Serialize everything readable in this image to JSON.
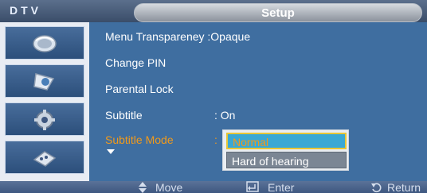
{
  "header": {
    "brand": "DTV",
    "title": "Setup"
  },
  "sidebar": {
    "items": [
      {
        "icon": "satellite-dish-icon"
      },
      {
        "icon": "picture-icon"
      },
      {
        "icon": "gear-icon"
      },
      {
        "icon": "input-icon"
      }
    ]
  },
  "menu": {
    "items": [
      {
        "label": "Menu Transpareney :Opaque",
        "value": ""
      },
      {
        "label": "Change PIN",
        "value": ""
      },
      {
        "label": "Parental Lock",
        "value": ""
      },
      {
        "label": "Subtitle",
        "value": ": On"
      },
      {
        "label": "Subtitle Mode",
        "value": ":"
      }
    ],
    "highlight_color": "#f29a1a"
  },
  "dropdown": {
    "options": [
      "Normal",
      "Hard of hearing"
    ],
    "selected": "Normal"
  },
  "footer": {
    "move_label": "Move",
    "enter_label": "Enter",
    "return_label": "Return"
  }
}
